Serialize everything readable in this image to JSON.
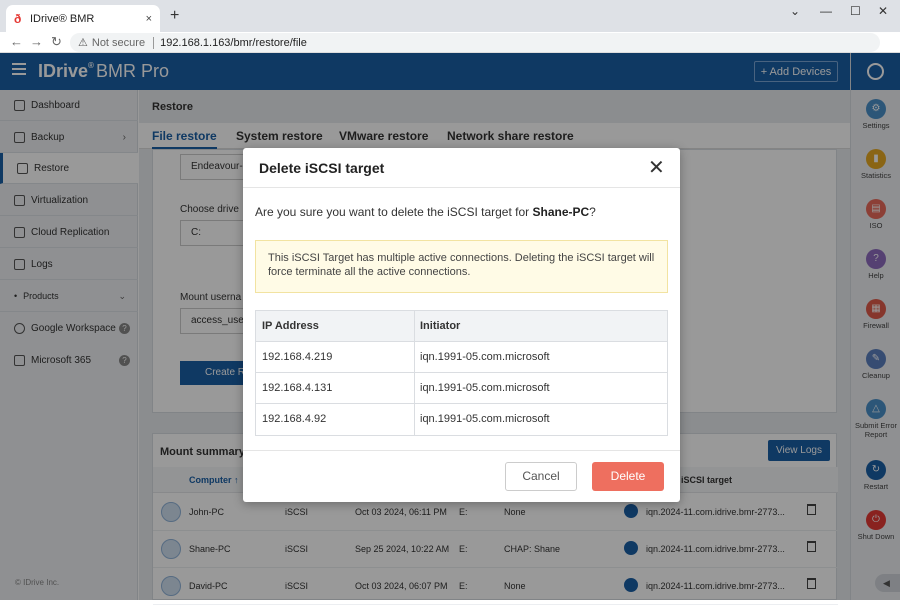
{
  "browser": {
    "tab_title": "IDrive® BMR",
    "tab_close": "×",
    "new_tab": "+",
    "not_secure": "Not secure",
    "url": "192.168.1.163/bmr/restore/file"
  },
  "header": {
    "brand_idrive": "IDrive",
    "brand_sup": "®",
    "brand_bmr": "BMR Pro",
    "add_devices": "+ Add Devices"
  },
  "sidebar": {
    "items": [
      {
        "label": "Dashboard"
      },
      {
        "label": "Backup"
      },
      {
        "label": "Restore"
      },
      {
        "label": "Virtualization"
      },
      {
        "label": "Cloud Replication"
      },
      {
        "label": "Logs"
      },
      {
        "label": "Products"
      },
      {
        "label": "Google Workspace"
      },
      {
        "label": "Microsoft 365"
      }
    ],
    "copyright": "© IDrive Inc."
  },
  "main": {
    "title": "Restore",
    "tabs": [
      {
        "label": "File restore"
      },
      {
        "label": "System restore"
      },
      {
        "label": "VMware restore"
      },
      {
        "label": "Network share restore"
      }
    ],
    "form": {
      "field1_value": "Endeavour-l",
      "choose_drive_label": "Choose drive",
      "choose_drive_value": "C:",
      "mount_user_label": "Mount userna",
      "mount_user_value": "access_user",
      "create_button": "Create R"
    },
    "mount_summary": {
      "title": "Mount summary",
      "view_logs": "View Logs",
      "columns": {
        "computer": "Computer ↑",
        "iscsi_target": "iSCSI target"
      },
      "rows": [
        {
          "computer": "John-PC",
          "type": "iSCSI",
          "date": "Oct 03 2024, 06:11 PM",
          "drive": "E:",
          "auth": "None",
          "target": "iqn.2024-11.com.idrive.bmr-2773..."
        },
        {
          "computer": "Shane-PC",
          "type": "iSCSI",
          "date": "Sep 25 2024, 10:22 AM",
          "drive": "E:",
          "auth": "CHAP: Shane",
          "target": "iqn.2024-11.com.idrive.bmr-2773..."
        },
        {
          "computer": "David-PC",
          "type": "iSCSI",
          "date": "Oct 03 2024, 06:07 PM",
          "drive": "E:",
          "auth": "None",
          "target": "iqn.2024-11.com.idrive.bmr-2773..."
        }
      ]
    }
  },
  "rail": {
    "items": [
      {
        "label": "Settings",
        "color": "#4a90c9"
      },
      {
        "label": "Statistics",
        "color": "#e6a822"
      },
      {
        "label": "ISO",
        "color": "#e96a5a"
      },
      {
        "label": "Help",
        "color": "#8e6bbf"
      },
      {
        "label": "Firewall",
        "color": "#e05a4a"
      },
      {
        "label": "Cleanup",
        "color": "#5b7fbf"
      },
      {
        "label": "Submit Error Report",
        "color": "#4a90c9"
      },
      {
        "label": "Restart",
        "color": "#1a5fa6"
      },
      {
        "label": "Shut Down",
        "color": "#e53935"
      }
    ]
  },
  "modal": {
    "title": "Delete iSCSI target",
    "question_prefix": "Are you sure you want to delete the iSCSI target for ",
    "question_target": "Shane-PC",
    "question_suffix": "?",
    "warning": "This iSCSI Target has multiple active connections. Deleting the iSCSI target will force terminate all the active connections.",
    "table": {
      "headers": [
        "IP Address",
        "Initiator"
      ],
      "rows": [
        [
          "192.168.4.219",
          "iqn.1991-05.com.microsoft"
        ],
        [
          "192.168.4.131",
          "iqn.1991-05.com.microsoft"
        ],
        [
          "192.168.4.92",
          "iqn.1991-05.com.microsoft"
        ]
      ]
    },
    "cancel": "Cancel",
    "delete": "Delete"
  }
}
